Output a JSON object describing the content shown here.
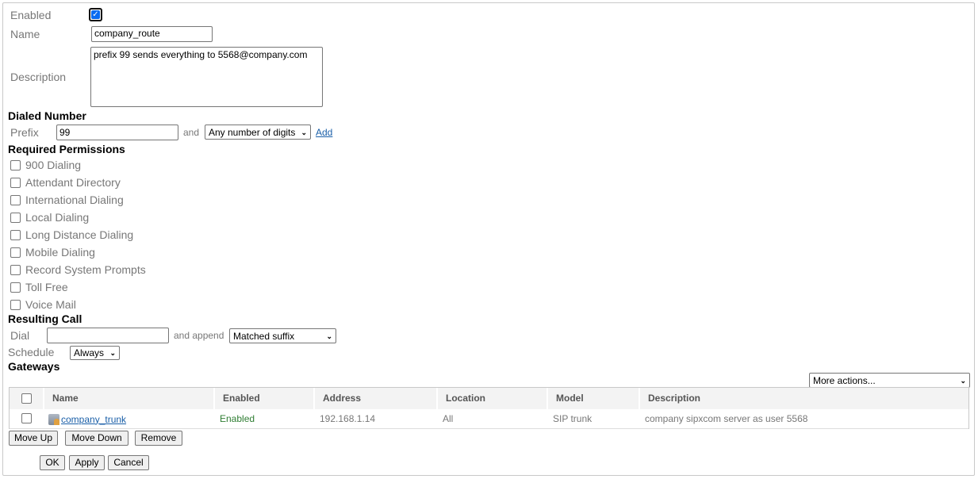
{
  "form": {
    "enabled_label": "Enabled",
    "enabled_checked": true,
    "name_label": "Name",
    "name_value": "company_route",
    "description_label": "Description",
    "description_value": "prefix 99 sends everything to 5568@company.com"
  },
  "dialed_number": {
    "heading": "Dialed Number",
    "prefix_label": "Prefix",
    "prefix_value": "99",
    "and_label": "and",
    "digits_select": "Any number of digits",
    "add_link": "Add"
  },
  "permissions": {
    "heading": "Required Permissions",
    "items": [
      {
        "label": "900 Dialing",
        "checked": false
      },
      {
        "label": "Attendant Directory",
        "checked": false
      },
      {
        "label": "International Dialing",
        "checked": false
      },
      {
        "label": "Local Dialing",
        "checked": false
      },
      {
        "label": "Long Distance Dialing",
        "checked": false
      },
      {
        "label": "Mobile Dialing",
        "checked": false
      },
      {
        "label": "Record System Prompts",
        "checked": false
      },
      {
        "label": "Toll Free",
        "checked": false
      },
      {
        "label": "Voice Mail",
        "checked": false
      }
    ]
  },
  "resulting_call": {
    "heading": "Resulting Call",
    "dial_label": "Dial",
    "dial_value": "",
    "append_label": "and append",
    "append_select": "Matched suffix",
    "schedule_label": "Schedule",
    "schedule_select": "Always"
  },
  "gateways": {
    "heading": "Gateways",
    "more_actions": "More actions...",
    "columns": [
      "Name",
      "Enabled",
      "Address",
      "Location",
      "Model",
      "Description"
    ],
    "rows": [
      {
        "name": "company_trunk",
        "enabled": "Enabled",
        "address": "192.168.1.14",
        "location": "All",
        "model": "SIP trunk",
        "description": "company sipxcom server as user 5568"
      }
    ],
    "enabled_color": "#2e7d32",
    "buttons": {
      "move_up": "Move Up",
      "move_down": "Move Down",
      "remove": "Remove"
    }
  },
  "footer": {
    "ok": "OK",
    "apply": "Apply",
    "cancel": "Cancel"
  },
  "colors": {
    "accent": "#0b6cf0",
    "link": "#1a5fa8",
    "label": "#777777"
  }
}
